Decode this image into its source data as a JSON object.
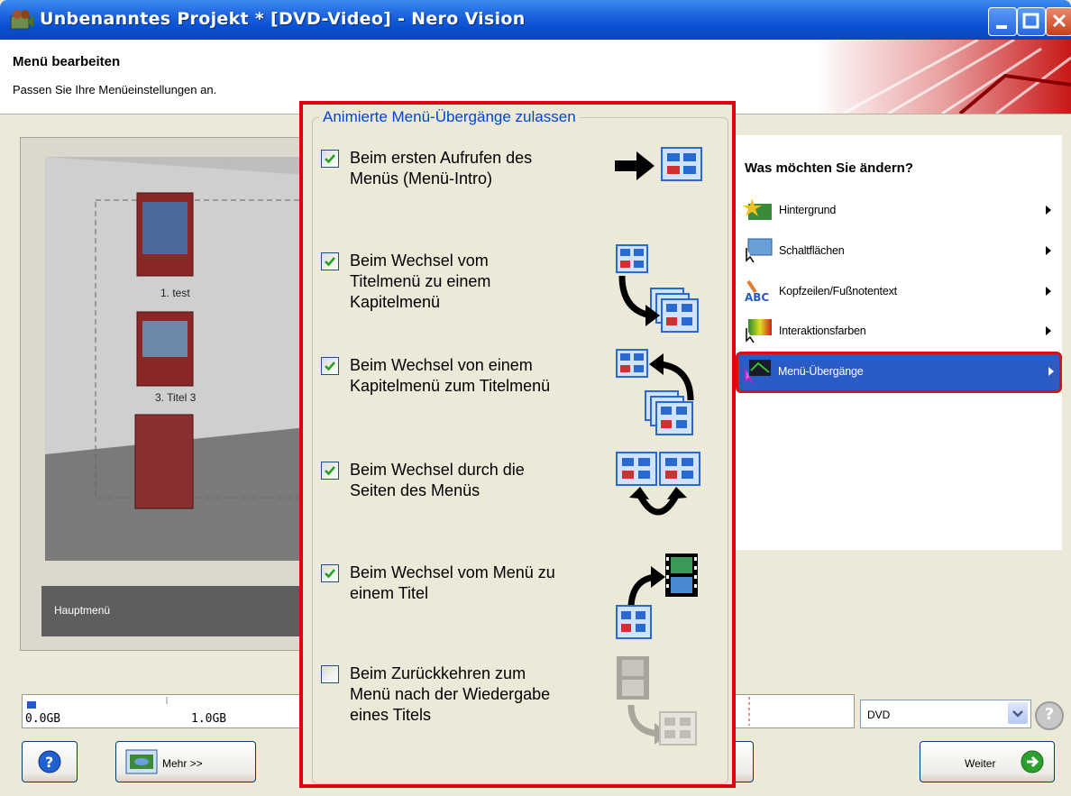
{
  "window": {
    "title": "Unbenanntes Projekt * [DVD-Video] - Nero Vision"
  },
  "header": {
    "title": "Menü bearbeiten",
    "subtitle": "Passen Sie Ihre Menüeinstellungen an."
  },
  "preview": {
    "items": [
      "1. test",
      "3. Titel 3"
    ],
    "bottom_label": "Hauptmenü"
  },
  "popup": {
    "group_title": "Animierte Menü-Übergänge zulassen",
    "options": [
      {
        "label_lines": [
          "Beim ersten Aufrufen des",
          "Menüs (Menü-Intro)"
        ],
        "checked": true
      },
      {
        "label_lines": [
          "Beim Wechsel vom",
          "Titelmenü zu einem",
          "Kapitelmenü"
        ],
        "checked": true
      },
      {
        "label_lines": [
          "Beim Wechsel von einem",
          "Kapitelmenü zum Titelmenü"
        ],
        "checked": true
      },
      {
        "label_lines": [
          "Beim Wechsel durch die",
          "Seiten des Menüs"
        ],
        "checked": true
      },
      {
        "label_lines": [
          "Beim Wechsel vom Menü zu",
          "einem Titel"
        ],
        "checked": true
      },
      {
        "label_lines": [
          "Beim Zurückkehren zum",
          "Menü nach der Wiedergabe",
          "eines Titels"
        ],
        "checked": false
      }
    ]
  },
  "right_panel": {
    "title": "Was möchten Sie ändern?",
    "items": [
      {
        "label": "Hintergrund",
        "icon": "background-icon"
      },
      {
        "label": "Schaltflächen",
        "icon": "buttons-icon"
      },
      {
        "label": "Kopfzeilen/Fußnotentext",
        "icon": "text-icon"
      },
      {
        "label": "Interaktionsfarben",
        "icon": "palette-icon"
      },
      {
        "label": "Menü-Übergänge",
        "icon": "transitions-icon",
        "selected": true
      }
    ]
  },
  "capacity": {
    "labels": [
      "0.0GB",
      "1.0GB"
    ],
    "disc_type": "DVD"
  },
  "buttons": {
    "help": "?",
    "mehr": "Mehr >>",
    "weiter": "Weiter"
  },
  "colors": {
    "accent_blue": "#0046d5",
    "highlight_red": "#e00010",
    "selection_blue": "#2b5bc4"
  }
}
